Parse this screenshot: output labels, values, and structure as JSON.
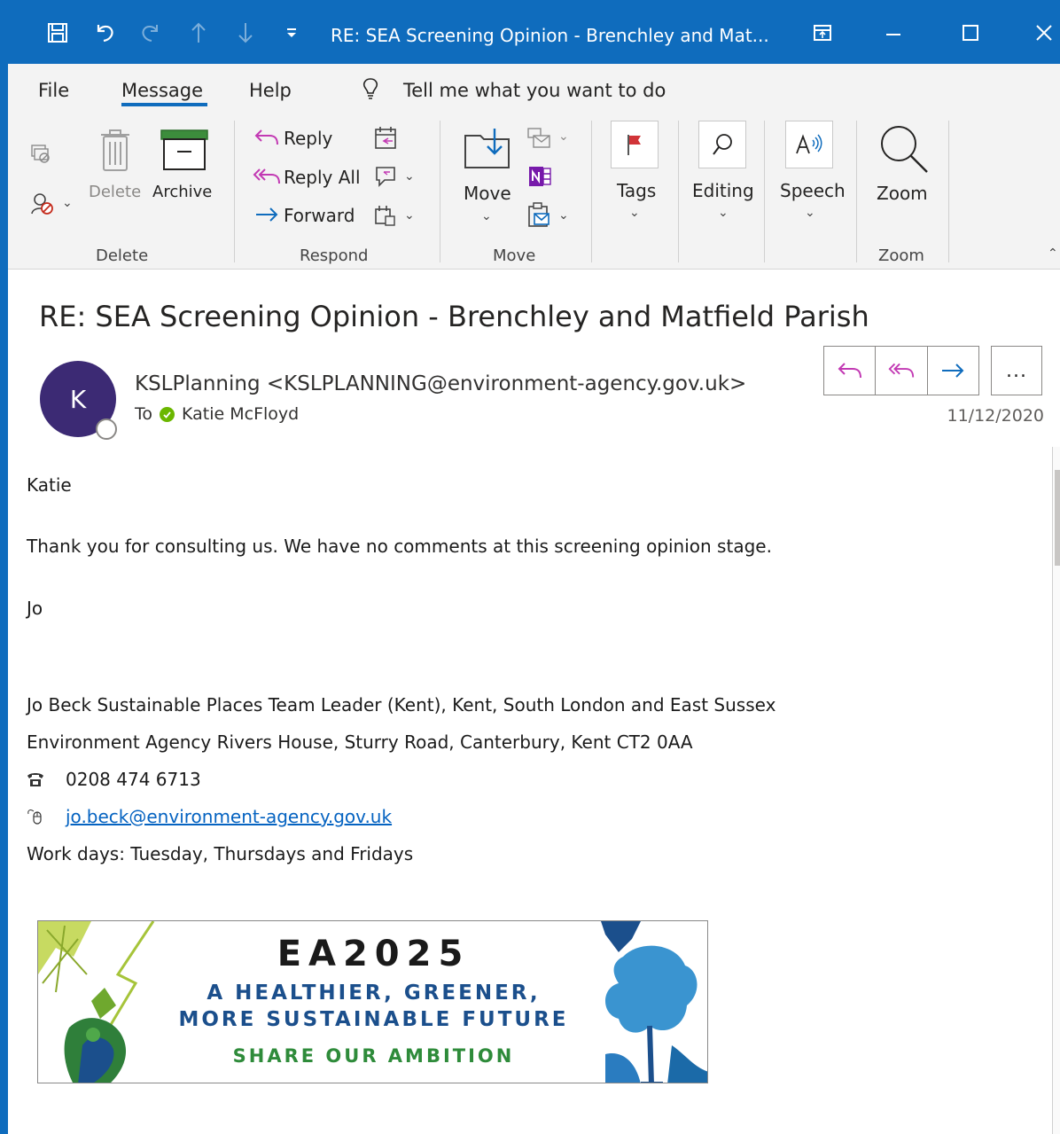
{
  "window": {
    "title": "RE: SEA Screening Opinion - Brenchley and Mat...",
    "icons": [
      "save-icon",
      "undo-icon",
      "redo-icon",
      "up-arrow-icon",
      "down-arrow-icon",
      "customize-qat-icon",
      "restore-ribbon-icon",
      "minimize-icon",
      "maximize-icon",
      "close-icon"
    ],
    "accent": "#0f6cbd"
  },
  "tabs": [
    {
      "label": "File"
    },
    {
      "label": "Message",
      "active": true
    },
    {
      "label": "Help"
    }
  ],
  "tell_me": "Tell me what you want to do",
  "ribbon": {
    "delete_group": {
      "label": "Delete",
      "delete": "Delete",
      "archive": "Archive"
    },
    "respond_group": {
      "label": "Respond",
      "reply": "Reply",
      "reply_all": "Reply All",
      "forward": "Forward"
    },
    "move_group": {
      "label": "Move",
      "move": "Move"
    },
    "tags": "Tags",
    "editing": "Editing",
    "speech": "Speech",
    "zoom_group": {
      "label": "Zoom",
      "zoom": "Zoom"
    }
  },
  "message": {
    "subject": "RE: SEA Screening Opinion - Brenchley and Matfield Parish",
    "avatar_initial": "K",
    "avatar_color": "#3c2a74",
    "sender": "KSLPlanning <KSLPLANNING@environment-agency.gov.uk>",
    "to_label": "To",
    "recipient": "Katie McFloyd",
    "date": "11/12/2020",
    "more": "..."
  },
  "body": {
    "greeting": "Katie",
    "para1": "Thank you for consulting us. We have no comments at this screening opinion stage.",
    "signoff": "Jo",
    "sig_line1": "Jo Beck Sustainable Places Team Leader (Kent), Kent, South London and East Sussex",
    "sig_line2": "Environment Agency Rivers House, Sturry Road, Canterbury, Kent CT2 0AA",
    "phone": "0208 474 6713",
    "email": "jo.beck@environment-agency.gov.uk",
    "workdays": "Work days: Tuesday, Thursdays and Fridays"
  },
  "banner": {
    "title": "EA2025",
    "line1": "A HEALTHIER, GREENER,",
    "line2": "MORE SUSTAINABLE FUTURE",
    "line3": "SHARE OUR AMBITION"
  }
}
